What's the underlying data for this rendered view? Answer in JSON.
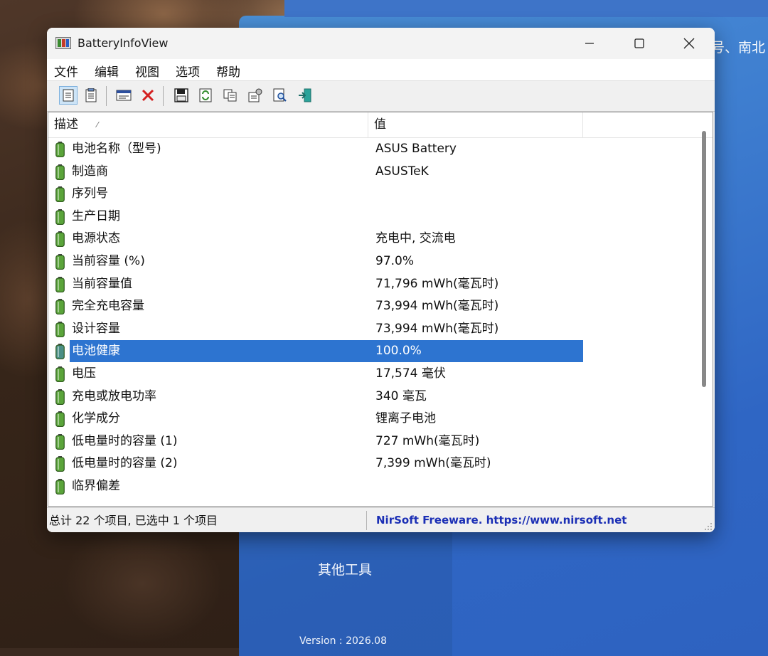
{
  "desktop": {
    "bg_app_text": "号、南北",
    "bg_app_other_tools": "其他工具",
    "bg_app_version": "Version : 2026.08"
  },
  "window": {
    "title": "BatteryInfoView",
    "controls": {
      "minimize": "minimize",
      "maximize": "maximize",
      "close": "close"
    }
  },
  "menu": [
    "文件",
    "编辑",
    "视图",
    "选项",
    "帮助"
  ],
  "toolbar": {
    "icons": [
      "properties-icon",
      "html-report-icon",
      "columns-icon",
      "delete-icon",
      "save-icon",
      "refresh-icon",
      "copy-icon",
      "options-icon",
      "find-icon",
      "exit-icon"
    ]
  },
  "columns": {
    "description": "描述",
    "value": "值"
  },
  "rows": [
    {
      "name": "电池名称（型号)",
      "value": "ASUS Battery"
    },
    {
      "name": "制造商",
      "value": "ASUSTeK"
    },
    {
      "name": "序列号",
      "value": ""
    },
    {
      "name": "生产日期",
      "value": ""
    },
    {
      "name": "电源状态",
      "value": "充电中, 交流电"
    },
    {
      "name": "当前容量 (%)",
      "value": "97.0%"
    },
    {
      "name": "当前容量值",
      "value": "71,796 mWh(毫瓦时)"
    },
    {
      "name": "完全充电容量",
      "value": "73,994 mWh(毫瓦时)"
    },
    {
      "name": "设计容量",
      "value": "73,994 mWh(毫瓦时)"
    },
    {
      "name": "电池健康",
      "value": "100.0%",
      "selected": true
    },
    {
      "name": "电压",
      "value": "17,574 毫伏"
    },
    {
      "name": "充电或放电功率",
      "value": "340 毫瓦"
    },
    {
      "name": "化学成分",
      "value": "锂离子电池"
    },
    {
      "name": "低电量时的容量 (1)",
      "value": "727 mWh(毫瓦时)"
    },
    {
      "name": "低电量时的容量 (2)",
      "value": "7,399 mWh(毫瓦时)"
    },
    {
      "name": "临界偏差",
      "value": ""
    }
  ],
  "status": {
    "summary": "总计 22 个项目, 已选中 1 个项目",
    "link": "NirSoft Freeware. https://www.nirsoft.net"
  },
  "colors": {
    "selection": "#2d74d0",
    "link": "#1b2fb5",
    "battery_green": "#5aa43a"
  }
}
